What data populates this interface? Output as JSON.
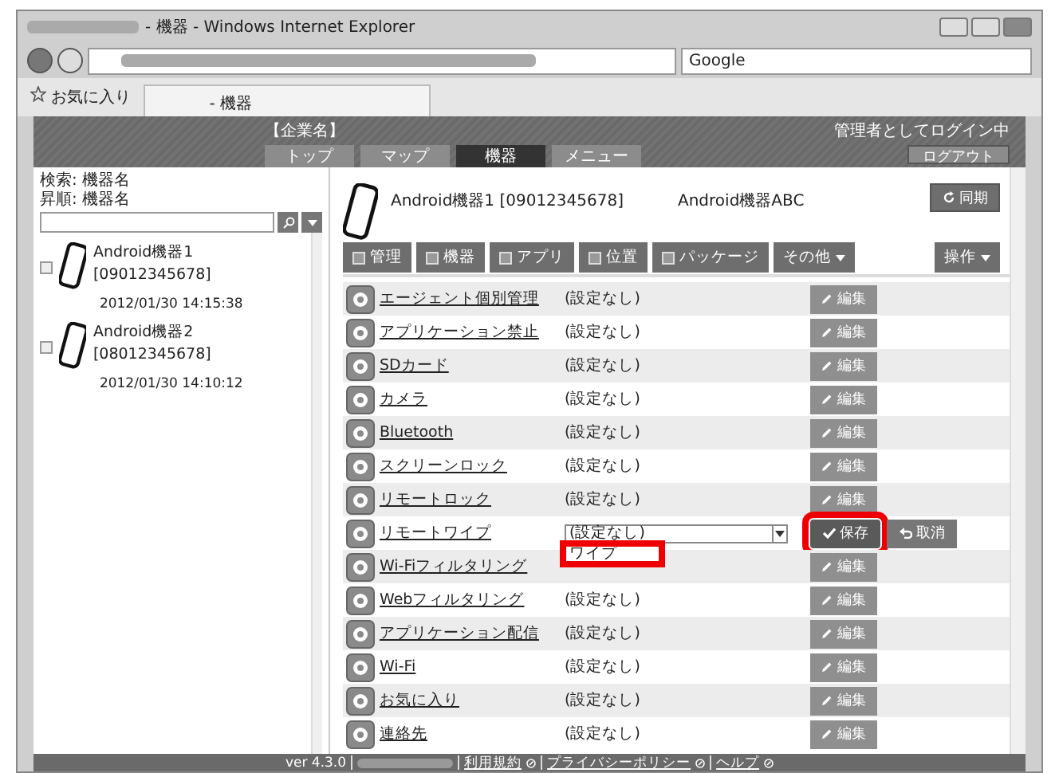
{
  "window": {
    "title": "- 機器 - Windows Internet Explorer"
  },
  "address_bar": {
    "search_value": "Google"
  },
  "favorites_bar": {
    "favorites": "お気に入り",
    "tab_title": "- 機器"
  },
  "header": {
    "company": "【企業名】",
    "login_status": "管理者としてログイン中",
    "logout": "ログアウト",
    "nav": [
      {
        "label": "トップ",
        "selected": false
      },
      {
        "label": "マップ",
        "selected": false
      },
      {
        "label": "機器",
        "selected": true
      },
      {
        "label": "メニュー",
        "selected": false
      }
    ]
  },
  "sidebar": {
    "search_label": "検索: 機器名",
    "sort_label": "昇順: 機器名",
    "devices": [
      {
        "name": "Android機器1 [09012345678]",
        "date": "2012/01/30 14:15:38",
        "checked": false
      },
      {
        "name": "Android機器2 [08012345678]",
        "date": "2012/01/30 14:10:12",
        "checked": false
      }
    ]
  },
  "device": {
    "name": "Android機器1 [09012345678]",
    "model": "Android機器ABC",
    "sync": "同期"
  },
  "toolbar": {
    "tabs": [
      {
        "label": "管理",
        "kind": "icon"
      },
      {
        "label": "機器",
        "kind": "icon"
      },
      {
        "label": "アプリ",
        "kind": "icon"
      },
      {
        "label": "位置",
        "kind": "icon"
      },
      {
        "label": "パッケージ",
        "kind": "icon"
      },
      {
        "label": "その他",
        "kind": "menu"
      }
    ],
    "actions": "操作"
  },
  "settings": [
    {
      "name": "エージェント個別管理",
      "value": "(設定なし)",
      "kind": "view",
      "edit": "編集",
      "disabled": true
    },
    {
      "name": "アプリケーション禁止",
      "value": "(設定なし)",
      "kind": "view",
      "edit": "編集",
      "disabled": true
    },
    {
      "name": "SDカード",
      "value": "(設定なし)",
      "kind": "view",
      "edit": "編集",
      "disabled": true
    },
    {
      "name": "カメラ",
      "value": "(設定なし)",
      "kind": "view",
      "edit": "編集",
      "disabled": true
    },
    {
      "name": "Bluetooth",
      "value": "(設定なし)",
      "kind": "view",
      "edit": "編集",
      "disabled": true
    },
    {
      "name": "スクリーンロック",
      "value": "(設定なし)",
      "kind": "view",
      "edit": "編集",
      "disabled": true
    },
    {
      "name": "リモートロック",
      "value": "(設定なし)",
      "kind": "view",
      "edit": "編集",
      "disabled": true
    },
    {
      "name": "リモートワイプ",
      "value": "(設定なし)",
      "kind": "editing",
      "save": "保存",
      "cancel": "取消",
      "save_highlighted": true,
      "option": "ワイプ",
      "option_highlighted": true
    },
    {
      "name": "Wi-Fiフィルタリング",
      "kind": "view",
      "edit": "編集",
      "disabled": true
    },
    {
      "name": "Webフィルタリング",
      "value": "(設定なし)",
      "kind": "view",
      "edit": "編集",
      "disabled": true
    },
    {
      "name": "アプリケーション配信",
      "value": "(設定なし)",
      "kind": "view",
      "edit": "編集",
      "disabled": true
    },
    {
      "name": "Wi-Fi",
      "value": "(設定なし)",
      "kind": "view",
      "edit": "編集",
      "disabled": true
    },
    {
      "name": "お気に入り",
      "value": "(設定なし)",
      "kind": "view",
      "edit": "編集",
      "disabled": true
    },
    {
      "name": "連絡先",
      "value": "(設定なし)",
      "kind": "view",
      "edit": "編集",
      "disabled": true
    }
  ],
  "footer": {
    "version": "ver 4.3.0",
    "links": [
      "利用規約",
      "プライバシーポリシー",
      "ヘルプ"
    ]
  }
}
